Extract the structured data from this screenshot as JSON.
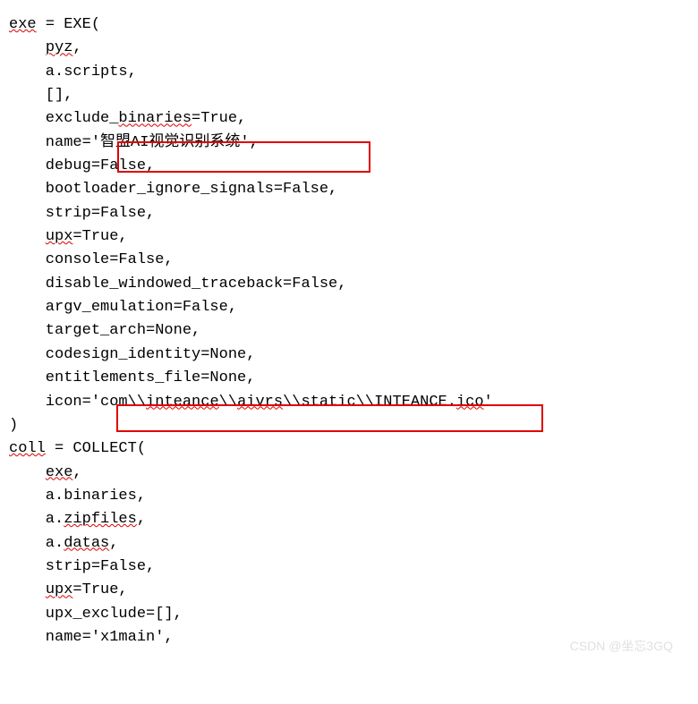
{
  "code": {
    "l1_a": "exe",
    "l1_b": " = EXE(",
    "l2_a": "    ",
    "l2_b": "pyz",
    "l2_c": ",",
    "l3": "    a.scripts,",
    "l4": "    [],",
    "l5_a": "    exclude_",
    "l5_b": "binaries",
    "l5_c": "=True,",
    "l6_a": "    name=",
    "l6_b": "'智盟AI视觉识别系统',",
    "l7": "    debug=False,",
    "l8": "    bootloader_ignore_signals=False,",
    "l9": "    strip=False,",
    "l10_a": "    ",
    "l10_b": "upx",
    "l10_c": "=True,",
    "l11": "    console=False,",
    "l12": "    disable_windowed_traceback=False,",
    "l13": "    argv_emulation=False,",
    "l14": "    target_arch=None,",
    "l15": "    codesign_identity=None,",
    "l16": "    entitlements_file=None,",
    "l17_a": "    icon=",
    "l17_b": "'com\\\\",
    "l17_c": "inteance",
    "l17_d": "\\\\",
    "l17_e": "aivrs",
    "l17_f": "\\\\static\\\\INTEANCE.",
    "l17_g": "ico",
    "l17_h": "'",
    "l18": ")",
    "l19_a": "coll",
    "l19_b": " = COLLECT(",
    "l20_a": "    ",
    "l20_b": "exe",
    "l20_c": ",",
    "l21": "    a.binaries,",
    "l22_a": "    a.",
    "l22_b": "zipfiles",
    "l22_c": ",",
    "l23_a": "    a.",
    "l23_b": "datas",
    "l23_c": ",",
    "l24": "    strip=False,",
    "l25_a": "    ",
    "l25_b": "upx",
    "l25_c": "=True,",
    "l26": "    upx_exclude=[],",
    "l27": "    name='x1main',"
  },
  "watermark": "CSDN @坐忘3GQ"
}
